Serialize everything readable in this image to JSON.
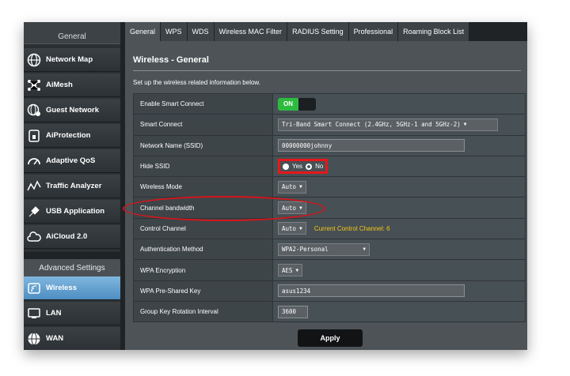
{
  "sidebar": {
    "general_header": "General",
    "items": [
      {
        "label": "Network Map",
        "icon": "globe-icon"
      },
      {
        "label": "AiMesh",
        "icon": "mesh-icon"
      },
      {
        "label": "Guest Network",
        "icon": "guest-network-icon"
      },
      {
        "label": "AiProtection",
        "icon": "lock-icon"
      },
      {
        "label": "Adaptive QoS",
        "icon": "speedometer-icon"
      },
      {
        "label": "Traffic Analyzer",
        "icon": "traffic-analyzer-icon"
      },
      {
        "label": "USB Application",
        "icon": "puzzle-icon"
      },
      {
        "label": "AiCloud 2.0",
        "icon": "cloud-icon"
      }
    ],
    "advanced_header": "Advanced Settings",
    "advanced_items": [
      {
        "label": "Wireless",
        "icon": "wireless-icon",
        "active": true
      },
      {
        "label": "LAN",
        "icon": "lan-icon"
      },
      {
        "label": "WAN",
        "icon": "wan-icon"
      }
    ]
  },
  "tabs": [
    {
      "label": "General",
      "active": true
    },
    {
      "label": "WPS"
    },
    {
      "label": "WDS"
    },
    {
      "label": "Wireless MAC Filter"
    },
    {
      "label": "RADIUS Setting"
    },
    {
      "label": "Professional"
    },
    {
      "label": "Roaming Block List"
    }
  ],
  "page": {
    "title": "Wireless - General",
    "description": "Set up the wireless related information below."
  },
  "settings": {
    "smart_connect_enable": {
      "label": "Enable Smart Connect",
      "toggle": "ON"
    },
    "smart_connect": {
      "label": "Smart Connect",
      "value": "Tri-Band Smart Connect (2.4GHz, 5GHz-1 and 5GHz-2)"
    },
    "ssid": {
      "label": "Network Name (SSID)",
      "value": "00000000johnny"
    },
    "hide_ssid": {
      "label": "Hide SSID",
      "yes": "Yes",
      "no": "No",
      "selected": "No"
    },
    "wireless_mode": {
      "label": "Wireless Mode",
      "value": "Auto"
    },
    "channel_bandwidth": {
      "label": "Channel bandwidth",
      "value": "Auto"
    },
    "control_channel": {
      "label": "Control Channel",
      "value": "Auto",
      "current": "Current Control Channel: 6"
    },
    "auth_method": {
      "label": "Authentication Method",
      "value": "WPA2-Personal"
    },
    "encryption": {
      "label": "WPA Encryption",
      "value": "AES"
    },
    "psk": {
      "label": "WPA Pre-Shared Key",
      "value": "asus1234"
    },
    "group_key": {
      "label": "Group Key Rotation Interval",
      "value": "3600"
    }
  },
  "apply_label": "Apply",
  "colors": {
    "accent_blue": "#5b9bd0",
    "toggle_green": "#2dbb3f",
    "highlight_red": "#e8161b",
    "channel_yellow": "#f5c518"
  }
}
